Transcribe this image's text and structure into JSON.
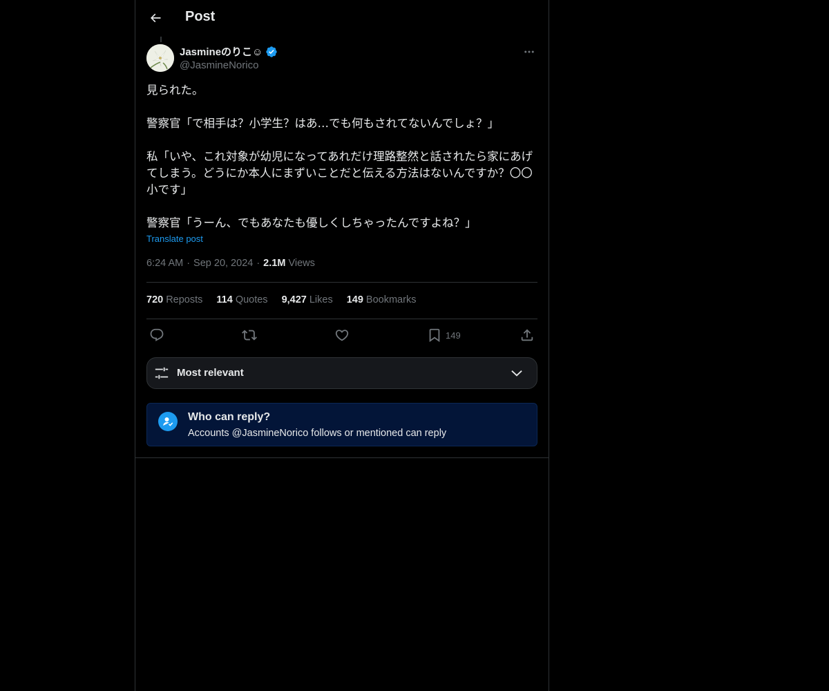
{
  "header": {
    "title": "Post",
    "back_icon": "arrow-left-icon"
  },
  "author": {
    "name": "Jasmineのりこ☺",
    "handle": "@JasmineNorico",
    "verified": true,
    "verified_color": "#1d9bf0"
  },
  "post": {
    "paragraphs": [
      "見られた。",
      "",
      "警察官「で相手は？小学生？はあ…でも何もされてないんでしょ？」",
      "",
      "私「いや、これ対象が幼児になってあれだけ理路整然と話されたら家にあげてしまう。どうにか本人にまずいことだと伝える方法はないんですか？〇〇小です」",
      "",
      "警察官「うーん、でもあなたも優しくしちゃったんですよね？」"
    ],
    "translate_label": "Translate post",
    "time": "6:24 AM",
    "separator": "·",
    "date": "Sep 20, 2024",
    "views_count": "2.1M",
    "views_label": "Views"
  },
  "stats": {
    "reposts": {
      "num": "720",
      "label": "Reposts"
    },
    "quotes": {
      "num": "114",
      "label": "Quotes"
    },
    "likes": {
      "num": "9,427",
      "label": "Likes"
    },
    "bookmarks": {
      "num": "149",
      "label": "Bookmarks"
    }
  },
  "actions": {
    "reply_icon": "reply-icon",
    "repost_icon": "repost-icon",
    "like_icon": "heart-icon",
    "bookmark_icon": "bookmark-icon",
    "bookmark_count": "149",
    "share_icon": "share-icon"
  },
  "sort": {
    "label": "Most relevant"
  },
  "reply_settings": {
    "title": "Who can reply?",
    "subtitle": "Accounts @JasmineNorico follows or mentioned can reply"
  },
  "colors": {
    "accent": "#1d9bf0",
    "background": "#000000",
    "border": "#2f3336",
    "muted_text": "#71767b",
    "reply_box_bg": "#031538"
  }
}
